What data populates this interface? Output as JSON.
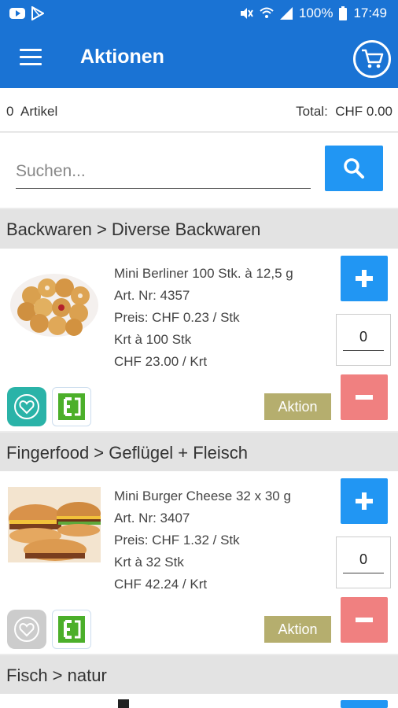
{
  "status": {
    "battery": "100%",
    "time": "17:49"
  },
  "appbar": {
    "title": "Aktionen"
  },
  "summary": {
    "count_value": "0",
    "count_label": "Artikel",
    "total_label": "Total:",
    "total_value": "CHF 0.00"
  },
  "search": {
    "placeholder": "Suchen..."
  },
  "sections": [
    {
      "category": "Backwaren > Diverse Backwaren",
      "product": {
        "name": "Mini Berliner 100 Stk. à 12,5 g",
        "art_nr": "Art. Nr: 4357",
        "price": "Preis: CHF 0.23  / Stk",
        "pack": "Krt à 100 Stk",
        "pack_price": "CHF 23.00  / Krt",
        "qty": "0",
        "badge": "Aktion",
        "favorite": true
      }
    },
    {
      "category": "Fingerfood > Geflügel + Fleisch",
      "product": {
        "name": "Mini Burger Cheese 32 x 30 g",
        "art_nr": "Art. Nr: 3407",
        "price": "Preis: CHF 1.32  / Stk",
        "pack": "Krt à 32 Stk",
        "pack_price": "CHF 42.24  / Krt",
        "qty": "0",
        "badge": "Aktion",
        "favorite": false
      }
    },
    {
      "category": "Fisch > natur"
    }
  ],
  "colors": {
    "primary": "#1a73d4",
    "button": "#2196f3",
    "minus": "#f08080",
    "badge": "#b5ae6e",
    "favorite_active": "#2ab3a8",
    "favorite_inactive": "#cccccc"
  }
}
